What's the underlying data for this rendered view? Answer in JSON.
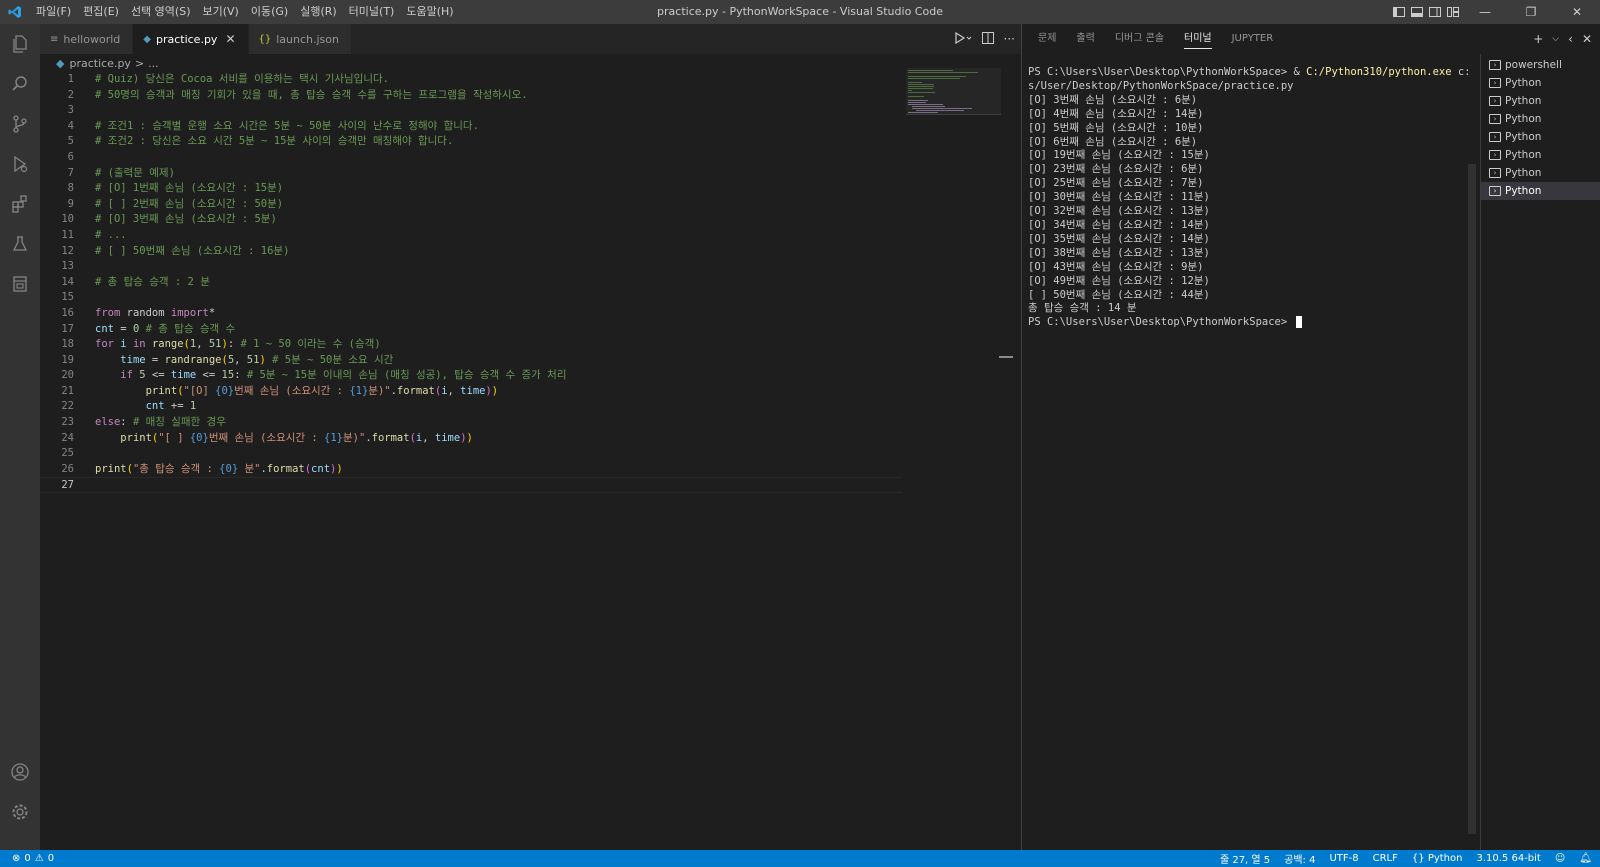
{
  "window": {
    "title": "practice.py - PythonWorkSpace - Visual Studio Code",
    "menu": [
      "파일(F)",
      "편집(E)",
      "선택 영역(S)",
      "보기(V)",
      "이동(G)",
      "실행(R)",
      "터미널(T)",
      "도움말(H)"
    ],
    "controls": {
      "minimize": "—",
      "restore": "❐",
      "close": "✕"
    }
  },
  "activity_bar": [
    "explorer-icon",
    "search-icon",
    "source-control-icon",
    "run-debug-icon",
    "extensions-icon",
    "testing-icon",
    "notebook-icon",
    "account-icon",
    "manage-gear-icon"
  ],
  "editor": {
    "tabs": [
      {
        "label": "helloworld",
        "icon": "≡",
        "active": false
      },
      {
        "label": "practice.py",
        "icon": "◆",
        "active": true,
        "close": "✕"
      },
      {
        "label": "launch.json",
        "icon": "{}",
        "active": false
      }
    ],
    "breadcrumb": {
      "file": "practice.py",
      "sep": ">",
      "rest": "..."
    },
    "current_line": 27,
    "line_numbers": [
      "1",
      "2",
      "3",
      "4",
      "5",
      "6",
      "7",
      "8",
      "9",
      "10",
      "11",
      "12",
      "13",
      "14",
      "15",
      "16",
      "17",
      "18",
      "19",
      "20",
      "21",
      "22",
      "23",
      "24",
      "25",
      "26",
      "27"
    ]
  },
  "panel": {
    "tabs": [
      "문제",
      "출력",
      "디버그 콘솔",
      "터미널",
      "JUPYTER"
    ],
    "active_tab": "터미널",
    "terminal_lines": [
      [
        "PS C:\\Users\\User\\Desktop\\PythonWorkSpace> & ",
        "C:/Python310/python.exe",
        " c:/Use"
      ],
      [
        "s/User/Desktop/PythonWorkSpace/practice.py"
      ],
      [
        "[O] 3번째 손님 (소요시간 : 6분)"
      ],
      [
        "[O] 4번째 손님 (소요시간 : 14분)"
      ],
      [
        "[O] 5번째 손님 (소요시간 : 10분)"
      ],
      [
        "[O] 6번째 손님 (소요시간 : 6분)"
      ],
      [
        "[O] 19번째 손님 (소요시간 : 15분)"
      ],
      [
        "[O] 23번째 손님 (소요시간 : 6분)"
      ],
      [
        "[O] 25번째 손님 (소요시간 : 7분)"
      ],
      [
        "[O] 30번째 손님 (소요시간 : 11분)"
      ],
      [
        "[O] 32번째 손님 (소요시간 : 13분)"
      ],
      [
        "[O] 34번째 손님 (소요시간 : 14분)"
      ],
      [
        "[O] 35번째 손님 (소요시간 : 14분)"
      ],
      [
        "[O] 38번째 손님 (소요시간 : 13분)"
      ],
      [
        "[O] 43번째 손님 (소요시간 : 9분)"
      ],
      [
        "[O] 49번째 손님 (소요시간 : 12분)"
      ],
      [
        "[ ] 50번째 손님 (소요시간 : 44분)"
      ],
      [
        "총 탑승 승객 : 14 분"
      ],
      [
        "PS C:\\Users\\User\\Desktop\\PythonWorkSpace> "
      ]
    ],
    "terminal_list": [
      {
        "label": "powershell",
        "active": false
      },
      {
        "label": "Python",
        "active": false
      },
      {
        "label": "Python",
        "active": false
      },
      {
        "label": "Python",
        "active": false
      },
      {
        "label": "Python",
        "active": false
      },
      {
        "label": "Python",
        "active": false
      },
      {
        "label": "Python",
        "active": false
      },
      {
        "label": "Python",
        "active": true
      }
    ]
  },
  "status_bar": {
    "errors": "0",
    "warnings": "0",
    "position": "줄 27, 열 5",
    "indent": "공백: 4",
    "encoding": "UTF-8",
    "eol": "CRLF",
    "language": "Python",
    "interpreter": "3.10.5 64-bit"
  },
  "colors": {
    "accent": "#007acc",
    "comment": "#6a9955",
    "keyword": "#c586c0",
    "function": "#dcdcaa",
    "variable": "#9cdcfe",
    "number": "#b5cea8",
    "string": "#ce9178"
  }
}
